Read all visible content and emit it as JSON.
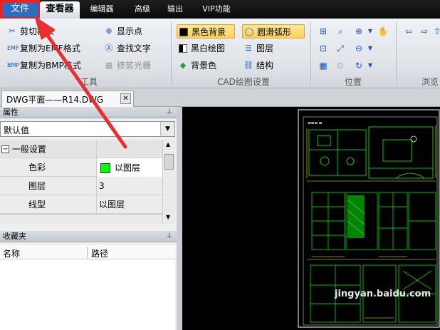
{
  "menubar": {
    "tabs": [
      "文件",
      "查看器",
      "编辑器",
      "高级",
      "输出",
      "VIP功能"
    ]
  },
  "ribbon": {
    "tools": {
      "crop_frame": "剪切框架",
      "copy_emf": "复制为EMF格式",
      "copy_bmp": "复制为BMP格式",
      "show_point": "显示点",
      "find_text": "查找文字",
      "trim_raster": "修剪光栅",
      "group_label": "工具"
    },
    "cad_settings": {
      "black_bg": "黑色背景",
      "smooth_arc": "圆滑弧形",
      "bw_draw": "黑白绘图",
      "layers": "图层",
      "bg_color": "背景色",
      "structure": "结构",
      "group_label": "CAD绘图设置"
    },
    "position": {
      "group_label": "位置"
    },
    "browse": {
      "group_label": "浏览"
    }
  },
  "document": {
    "tab_title": "DWG平面——R14.DWG"
  },
  "properties": {
    "title": "属性",
    "combo_value": "默认值",
    "group": "一般设置",
    "rows": [
      {
        "key": "色彩",
        "value": "以图层"
      },
      {
        "key": "图层",
        "value": "3"
      },
      {
        "key": "线型",
        "value": "以图层"
      }
    ]
  },
  "favorites": {
    "title": "收藏夹",
    "columns": [
      "名称",
      "路径"
    ]
  },
  "watermark": "jingyan.baidu.com",
  "colors": {
    "accent_blue": "#2b6cc4",
    "highlight_red": "#f0201a",
    "cad_green": "#00ff00",
    "cad_yellow": "#ffff00"
  }
}
